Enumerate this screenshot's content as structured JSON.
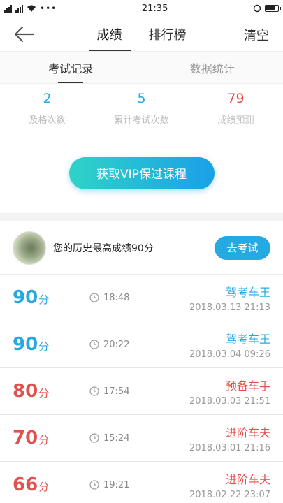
{
  "status": {
    "time": "21:35"
  },
  "nav": {
    "tabs": [
      {
        "label": "成绩"
      },
      {
        "label": "排行榜"
      }
    ],
    "clear": "清空"
  },
  "subtabs": [
    {
      "label": "考试记录"
    },
    {
      "label": "数据统计"
    }
  ],
  "stats": [
    {
      "value": "2",
      "label": "及格次数",
      "color": "#24a9e1"
    },
    {
      "value": "5",
      "label": "累计考试次数",
      "color": "#24a9e1"
    },
    {
      "value": "79",
      "label": "成绩预测",
      "color": "#e0524d"
    }
  ],
  "vip_button": "获取VIP保过课程",
  "best": {
    "text": "您的历史最高成绩90分",
    "button": "去考试"
  },
  "unit": "分",
  "records": [
    {
      "score": "90",
      "time": "18:48",
      "title": "驾考车王",
      "date": "2018.03.13  21:13",
      "color": "blue"
    },
    {
      "score": "90",
      "time": "20:22",
      "title": "驾考车王",
      "date": "2018.03.04  09:26",
      "color": "blue"
    },
    {
      "score": "80",
      "time": "17:54",
      "title": "预备车手",
      "date": "2018.03.03  21:51",
      "color": "red"
    },
    {
      "score": "70",
      "time": "15:24",
      "title": "进阶车夫",
      "date": "2018.03.01  21:16",
      "color": "red"
    },
    {
      "score": "66",
      "time": "19:21",
      "title": "进阶车夫",
      "date": "2018.02.22  23:07",
      "color": "red"
    }
  ]
}
